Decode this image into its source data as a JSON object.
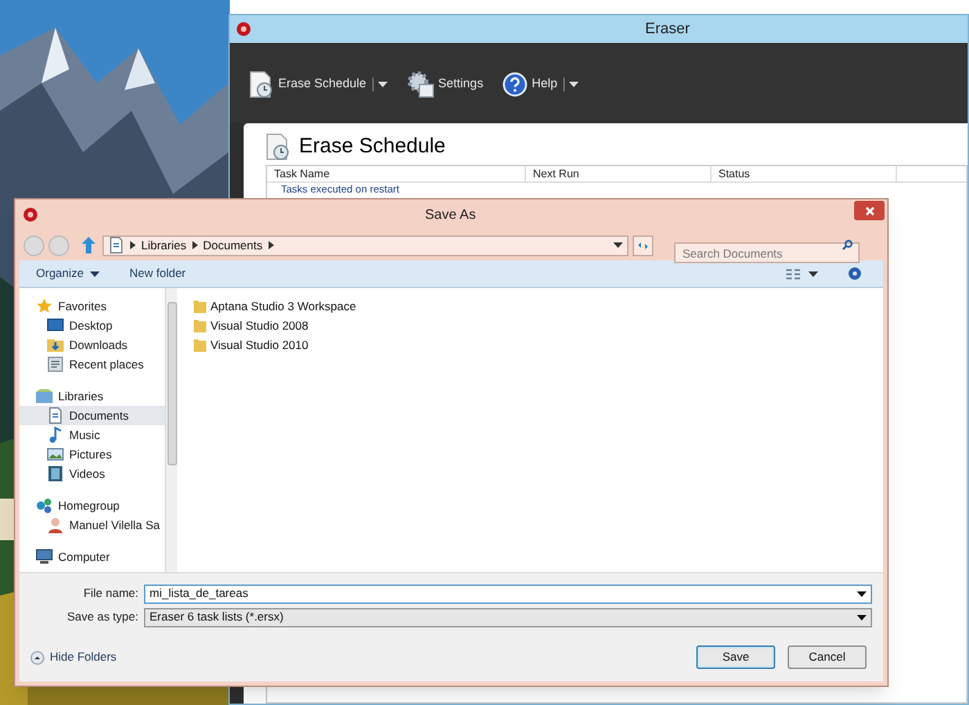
{
  "eraser_window": {
    "title": "Eraser",
    "toolbar": [
      {
        "label": "Erase Schedule",
        "kind": "schedule",
        "dropdown": true
      },
      {
        "label": "Settings",
        "kind": "settings",
        "dropdown": false
      },
      {
        "label": "Help",
        "kind": "help",
        "dropdown": true
      }
    ],
    "heading": "Erase Schedule",
    "columns": [
      "Task Name",
      "Next Run",
      "Status"
    ],
    "groups": [
      "Tasks executed on restart"
    ]
  },
  "save_dialog": {
    "title": "Save As",
    "breadcrumb": [
      "Libraries",
      "Documents"
    ],
    "search": {
      "placeholder": "Search Documents"
    },
    "commands": [
      {
        "label": "Organize",
        "dropdown": true
      },
      {
        "label": "New folder",
        "dropdown": false
      }
    ],
    "nav": [
      {
        "label": "Favorites",
        "kind": "star",
        "selected": false,
        "children": [
          {
            "label": "Desktop",
            "kind": "desktop",
            "selected": false
          },
          {
            "label": "Downloads",
            "kind": "downloads",
            "selected": false
          },
          {
            "label": "Recent places",
            "kind": "recent",
            "selected": false
          }
        ]
      },
      {
        "label": "Libraries",
        "kind": "library",
        "selected": false,
        "children": [
          {
            "label": "Documents",
            "kind": "documents",
            "selected": true
          },
          {
            "label": "Music",
            "kind": "music",
            "selected": false
          },
          {
            "label": "Pictures",
            "kind": "pictures",
            "selected": false
          },
          {
            "label": "Videos",
            "kind": "videos",
            "selected": false
          }
        ]
      },
      {
        "label": "Homegroup",
        "kind": "homegroup",
        "selected": false,
        "children": [
          {
            "label": "Manuel Vilella Sa",
            "kind": "user",
            "selected": false
          }
        ]
      },
      {
        "label": "Computer",
        "kind": "computer",
        "selected": false
      }
    ],
    "files": [
      "Aptana Studio 3 Workspace",
      "Visual Studio 2008",
      "Visual Studio 2010"
    ],
    "file_name": {
      "label": "File name:",
      "value": "mi_lista_de_tareas"
    },
    "save_type": {
      "label": "Save as type:",
      "value": "Eraser 6 task lists (*.ersx)"
    },
    "hide_folders": "Hide Folders",
    "buttons": [
      {
        "label": "Save",
        "default": true
      },
      {
        "label": "Cancel",
        "default": false
      }
    ]
  }
}
